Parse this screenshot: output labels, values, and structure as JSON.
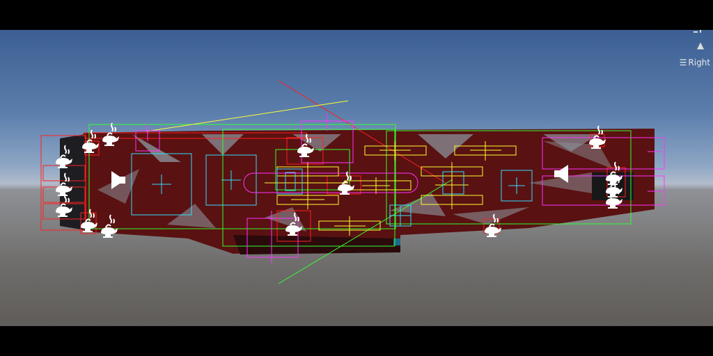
{
  "view_orientation": {
    "label": "Right",
    "icon": "hamburger-menu-icon"
  },
  "gizmo_icon": "scene-orientation-gizmo-icon",
  "colors": {
    "hull": "#5a1111",
    "hull_dark": "#3a0c0c",
    "stripe": "#8a9098",
    "gizmo_red": "#ff3333",
    "gizmo_green": "#33ff33",
    "gizmo_yellow": "#ffff33",
    "gizmo_cyan": "#33ffff",
    "gizmo_magenta": "#ff33ff"
  },
  "icons": {
    "light": "light-gizmo-icon",
    "audio": "audio-source-icon"
  }
}
